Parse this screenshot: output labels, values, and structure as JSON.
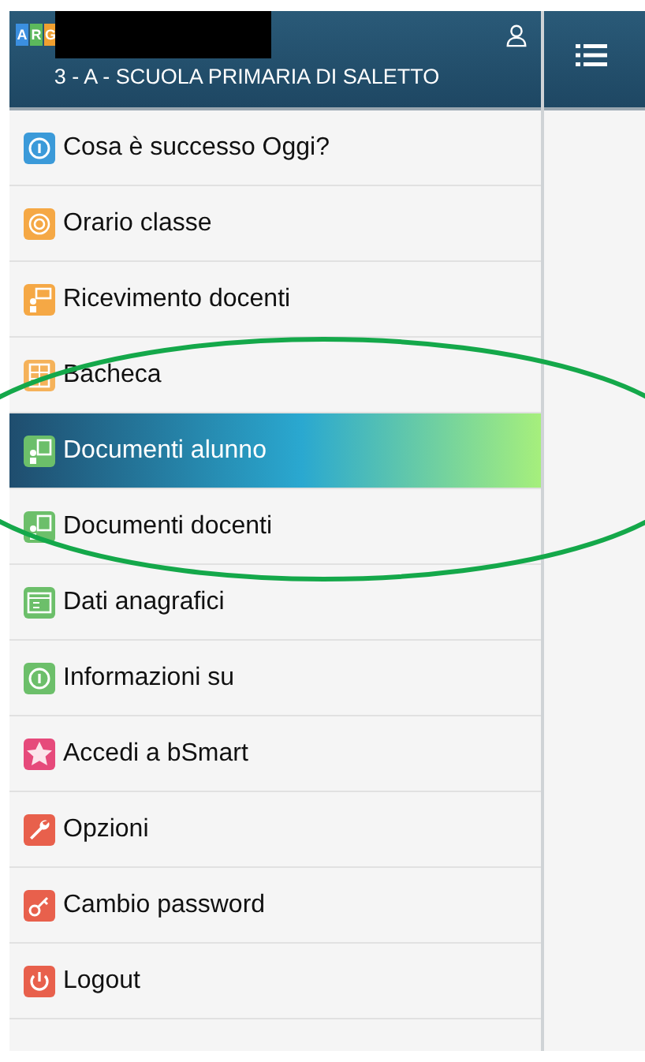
{
  "header": {
    "logo_letters": [
      "A",
      "R",
      "G"
    ],
    "class_name": "3 - A - SCUOLA PRIMARIA DI SALETTO"
  },
  "menu": [
    {
      "label": "Cosa è successo Oggi?",
      "color": "#3b9ad9",
      "selected": false
    },
    {
      "label": "Orario classe",
      "color": "#f5a845",
      "selected": false
    },
    {
      "label": "Ricevimento docenti",
      "color": "#f5a845",
      "selected": false
    },
    {
      "label": "Bacheca",
      "color": "#f5b25a",
      "selected": false
    },
    {
      "label": "Documenti alunno",
      "color": "#6cbf6a",
      "selected": true
    },
    {
      "label": "Documenti docenti",
      "color": "#6cbf6a",
      "selected": false
    },
    {
      "label": "Dati anagrafici",
      "color": "#6cbf6a",
      "selected": false
    },
    {
      "label": "Informazioni su",
      "color": "#6cbf6a",
      "selected": false
    },
    {
      "label": "Accedi a bSmart",
      "color": "#e64a7b",
      "selected": false
    },
    {
      "label": "Opzioni",
      "color": "#e8604c",
      "selected": false
    },
    {
      "label": "Cambio password",
      "color": "#e8604c",
      "selected": false
    },
    {
      "label": "Logout",
      "color": "#e8604c",
      "selected": false
    }
  ]
}
